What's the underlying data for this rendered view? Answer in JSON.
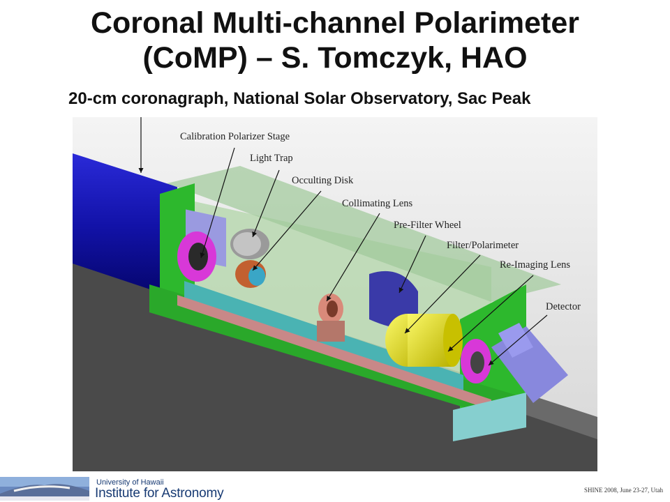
{
  "title_line1": "Coronal Multi-channel Polarimeter",
  "title_line2": "(CoMP) – S. Tomczyk, HAO",
  "subtitle": "20-cm coronagraph, National Solar Observatory, Sac Peak",
  "callouts": [
    "Calibration Polarizer Stage",
    "Light Trap",
    "Occulting Disk",
    "Collimating Lens",
    "Pre-Filter Wheel",
    "Filter/Polarimeter",
    "Re-Imaging Lens",
    "Detector"
  ],
  "footer": {
    "logo_line1": "University of Hawaii",
    "logo_line2": "Institute for Astronomy",
    "note": "SHINE 2008, June 23-27, Utah"
  }
}
